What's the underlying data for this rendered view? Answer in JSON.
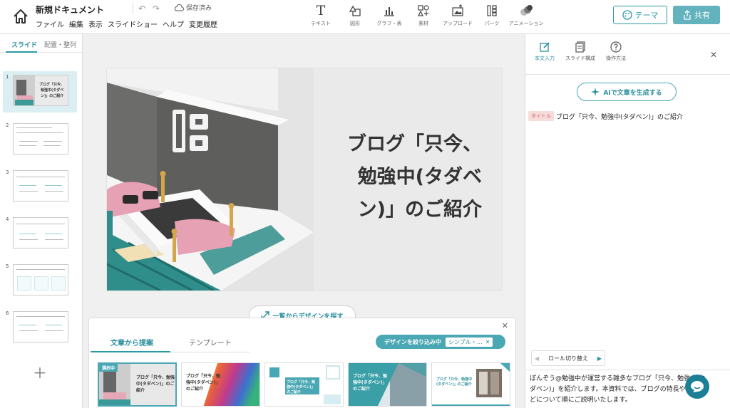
{
  "header": {
    "doc_title": "新規ドキュメント",
    "saved_label": "保存済み",
    "menu": [
      "ファイル",
      "編集",
      "表示",
      "スライドショー",
      "ヘルプ",
      "変更履歴"
    ],
    "tools": [
      {
        "label": "テキスト",
        "icon": "text-icon"
      },
      {
        "label": "図形",
        "icon": "shape-icon"
      },
      {
        "label": "グラフ・表",
        "icon": "chart-icon"
      },
      {
        "label": "素材",
        "icon": "material-icon"
      },
      {
        "label": "アップロード",
        "icon": "upload-icon"
      },
      {
        "label": "パーツ",
        "icon": "parts-icon"
      },
      {
        "label": "アニメーション",
        "icon": "animation-icon"
      }
    ],
    "theme_label": "テーマ",
    "share_label": "共有"
  },
  "left_panel": {
    "tab_slides": "スライド",
    "tab_layout": "配置・整列",
    "slides": [
      "1",
      "2",
      "3",
      "4",
      "5",
      "6"
    ],
    "selected_slide": "1"
  },
  "slide": {
    "title_lines": [
      "ブログ「只今、",
      "勉強中(タダベ",
      "ン)」のご紹介"
    ]
  },
  "canvas": {
    "find_design_label": "一覧からデザインを探す"
  },
  "design_panel": {
    "tab_suggest": "文章から提案",
    "tab_template": "テンプレート",
    "filter_label": "デザインを絞り込み中",
    "filter_value": "シンプル・…",
    "selected_badge": "選択中",
    "cards": [
      {
        "title": "ブログ「只今、勉強中(タダベン)」のご紹介"
      },
      {
        "title": "ブログ「只今、勉強中(タダベン)」のご紹介"
      },
      {
        "title": "ブログ「只今、勉強中(タダベン)」のご紹介"
      },
      {
        "title": "ブログ「只今、勉強中(タダベン)」のご紹介"
      },
      {
        "title": "ブログ「只今、勉強中(タダベン)」のご紹介"
      }
    ]
  },
  "right_panel": {
    "tabs": [
      {
        "label": "本文入力",
        "icon": "edit-icon"
      },
      {
        "label": "スライド構成",
        "icon": "slides-icon"
      },
      {
        "label": "操作方法",
        "icon": "help-icon"
      }
    ],
    "ai_button": "AIで文章を生成する",
    "title_tag": "タイトル",
    "title_text": "ブログ「只今、勉強中(タダベン)」のご紹介",
    "role_switch": "ロール切り替え",
    "description": "ぽんぞう@勉強中が運営する雑多なブログ「只今、勉強中(タダベン)」を紹介します。本資料では、ブログの特長や目的などについて順にご説明いたします。"
  },
  "colors": {
    "accent": "#2b9aa7",
    "accent_light": "#4aa8b4",
    "chat": "#1b7f96"
  }
}
